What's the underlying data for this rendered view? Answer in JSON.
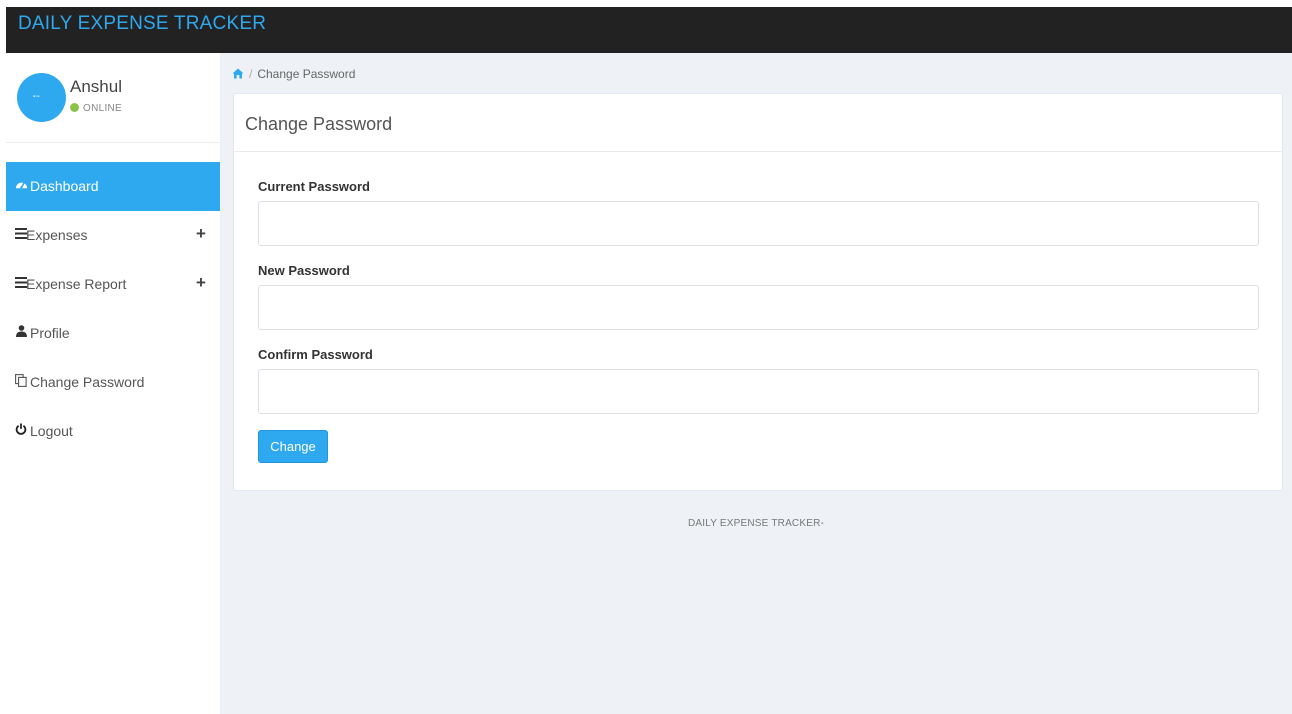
{
  "app": {
    "title": "DAILY EXPENSE TRACKER"
  },
  "colors": {
    "accent": "#2ea9f0",
    "topbar": "#222222",
    "status_online": "#8bc34a"
  },
  "user": {
    "name": "Anshul",
    "status": "ONLINE"
  },
  "sidebar": {
    "items": [
      {
        "label": "Dashboard",
        "icon": "dashboard-icon",
        "active": true
      },
      {
        "label": "Expenses",
        "icon": "list-icon",
        "expandable": true
      },
      {
        "label": "Expense Report",
        "icon": "list-icon",
        "expandable": true
      },
      {
        "label": "Profile",
        "icon": "user-icon"
      },
      {
        "label": "Change Password",
        "icon": "copy-icon"
      },
      {
        "label": "Logout",
        "icon": "power-icon"
      }
    ],
    "expand_symbol": "+"
  },
  "breadcrumb": {
    "home_icon": "home-icon",
    "separator": "/",
    "current": "Change Password"
  },
  "panel": {
    "title": "Change Password",
    "fields": [
      {
        "label": "Current Password",
        "value": "",
        "placeholder": ""
      },
      {
        "label": "New Password",
        "value": "",
        "placeholder": ""
      },
      {
        "label": "Confirm Password",
        "value": "",
        "placeholder": ""
      }
    ],
    "submit_label": "Change"
  },
  "footer": {
    "text": "DAILY EXPENSE TRACKER-"
  }
}
